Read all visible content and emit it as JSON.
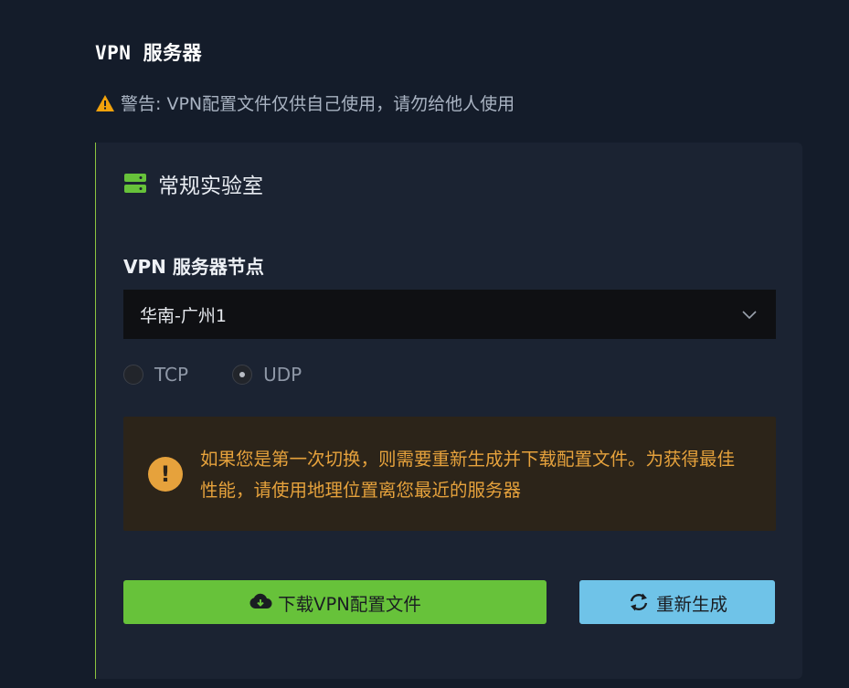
{
  "page": {
    "title": "VPN 服务器",
    "warning": "警告: VPN配置文件仅供自己使用，请勿给他人使用",
    "warning_icon": "warning-triangle-icon"
  },
  "card": {
    "title": "常规实验室",
    "icon": "server-icon",
    "accent_color": "#8cc43f"
  },
  "server_select": {
    "label": "VPN 服务器节点",
    "value": "华南-广州1"
  },
  "protocol": {
    "options": [
      {
        "label": "TCP",
        "checked": false
      },
      {
        "label": "UDP",
        "checked": true
      }
    ]
  },
  "notice": {
    "text": "如果您是第一次切换，则需要重新生成并下载配置文件。为获得最佳性能，请使用地理位置离您最近的服务器",
    "color": "#e6a23c"
  },
  "actions": {
    "download_label": "下载VPN配置文件",
    "download_color": "#67c23a",
    "regenerate_label": "重新生成",
    "regenerate_color": "#6fc3e8"
  }
}
